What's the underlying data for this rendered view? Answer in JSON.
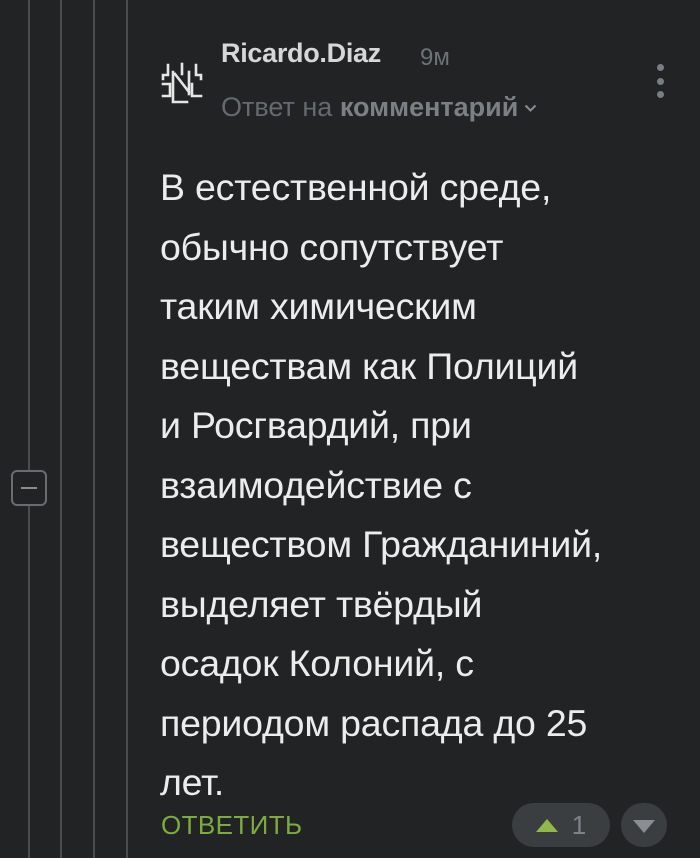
{
  "comment": {
    "author": "Ricardo.Diaz",
    "time": "9м",
    "reply_prefix": "Ответ на",
    "reply_target": "комментарий",
    "body": "В естественной среде,\nобычно сопутствует\nтаким химическим\nвеществам как Полиций\nи Росгвардий, при\nвзаимодействие с\nвеществом Гражданиний,\nвыделяет твёрдый\nосадок Колоний, с\nпериодом распада до 25\nлет."
  },
  "actions": {
    "reply_label": "ОТВЕТИТЬ",
    "rating": "1"
  },
  "icons": {
    "avatar": "avatar-glyph-icon",
    "menu": "more-vertical-icon",
    "collapse": "collapse-minus-icon",
    "chevron": "chevron-down-icon",
    "upvote": "upvote-icon",
    "downvote": "downvote-icon"
  },
  "colors": {
    "background": "#212325",
    "reply_accent": "#7dab3d",
    "upvote_accent": "#8fba4a"
  }
}
